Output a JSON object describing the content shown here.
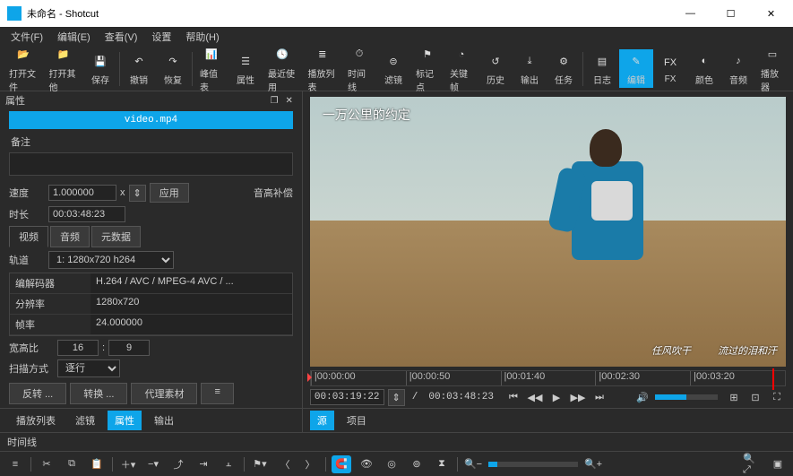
{
  "window": {
    "title": "未命名 - Shotcut",
    "min": "—",
    "max": "☐",
    "close": "✕"
  },
  "menu": [
    "文件(F)",
    "编辑(E)",
    "查看(V)",
    "设置",
    "帮助(H)"
  ],
  "toolbar": [
    {
      "icon": "folder-open",
      "label": "打开文件"
    },
    {
      "icon": "folder-plus",
      "label": "打开其他"
    },
    {
      "icon": "save",
      "label": "保存"
    },
    {
      "sep": true
    },
    {
      "icon": "undo",
      "label": "撤销"
    },
    {
      "icon": "redo",
      "label": "恢复"
    },
    {
      "sep": true
    },
    {
      "icon": "peaks",
      "label": "峰值表"
    },
    {
      "icon": "props",
      "label": "属性"
    },
    {
      "icon": "recent",
      "label": "最近使用"
    },
    {
      "icon": "playlist",
      "label": "播放列表"
    },
    {
      "icon": "timeline",
      "label": "时间线"
    },
    {
      "icon": "filters",
      "label": "滤镜"
    },
    {
      "icon": "markers",
      "label": "标记点"
    },
    {
      "icon": "keyframes",
      "label": "关键帧"
    },
    {
      "icon": "history",
      "label": "历史"
    },
    {
      "icon": "export",
      "label": "输出"
    },
    {
      "icon": "jobs",
      "label": "任务"
    },
    {
      "sep": true
    },
    {
      "icon": "log",
      "label": "日志"
    },
    {
      "icon": "edit",
      "label": "编辑",
      "active": true
    },
    {
      "icon": "fx",
      "label": "FX"
    },
    {
      "icon": "color",
      "label": "颜色"
    },
    {
      "icon": "audio",
      "label": "音频"
    },
    {
      "icon": "player",
      "label": "播放器"
    }
  ],
  "props": {
    "title": "属性",
    "file": "video.mp4",
    "notes_label": "备注",
    "speed": {
      "label": "速度",
      "value": "1.000000",
      "unit": "x",
      "apply": "应用",
      "pitch": "音高补偿"
    },
    "duration": {
      "label": "时长",
      "value": "00:03:48:23"
    },
    "tabs": [
      "视频",
      "音频",
      "元数据"
    ],
    "track": {
      "label": "轨道",
      "value": "1: 1280x720 h264"
    },
    "table": [
      {
        "k": "编解码器",
        "v": "H.264 / AVC / MPEG-4 AVC / ..."
      },
      {
        "k": "分辨率",
        "v": "1280x720"
      },
      {
        "k": "帧率",
        "v": "24.000000"
      }
    ],
    "aspect": {
      "label": "宽高比",
      "w": "16",
      "h": "9"
    },
    "scan": {
      "label": "扫描方式",
      "value": "逐行"
    },
    "buttons": [
      "反转 ...",
      "转换 ...",
      "代理素材"
    ],
    "bottom_tabs": [
      "播放列表",
      "滤镜",
      "属性",
      "输出"
    ]
  },
  "preview": {
    "sub_top": "一万公里的约定",
    "sub_bottom_left": "任风吹干",
    "sub_bottom_right": "流过的泪和汗",
    "ruler": [
      "|00:00:00",
      "|00:00:50",
      "|00:01:40",
      "|00:02:30",
      "|00:03:20"
    ],
    "tc": "00:03:19:22",
    "total": "00:03:48:23",
    "sep": "/",
    "tabs": [
      "源",
      "项目"
    ]
  },
  "timeline": {
    "title": "时间线"
  }
}
